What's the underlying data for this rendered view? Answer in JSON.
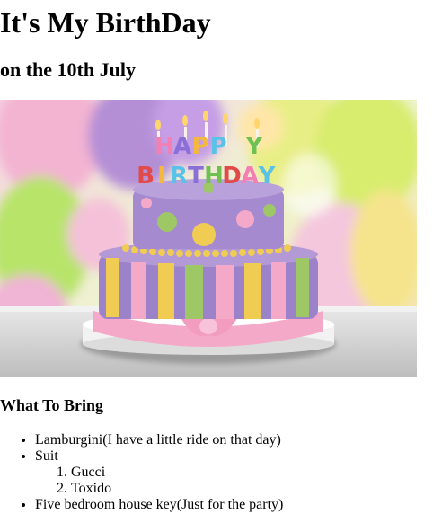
{
  "page": {
    "title": "It's My BirthDay",
    "subtitle": "on the 10th July"
  },
  "image": {
    "subject": "birthday-cake-photo",
    "candle_text": "HAPPY BIRTHDAY",
    "colors": {
      "cake_purple": "#9b82c9",
      "fondant_pink": "#f4a9c8",
      "fondant_yellow": "#f0cd52",
      "fondant_green": "#9ec865",
      "board_white": "#efefef"
    }
  },
  "bring": {
    "heading": "What To Bring",
    "items": [
      {
        "label": "Lamburgini(I have a little ride on that day)"
      },
      {
        "label": "Suit",
        "sub_items": [
          "Gucci",
          "Toxido"
        ]
      },
      {
        "label": "Five bedroom house key(Just for the party)"
      }
    ]
  }
}
